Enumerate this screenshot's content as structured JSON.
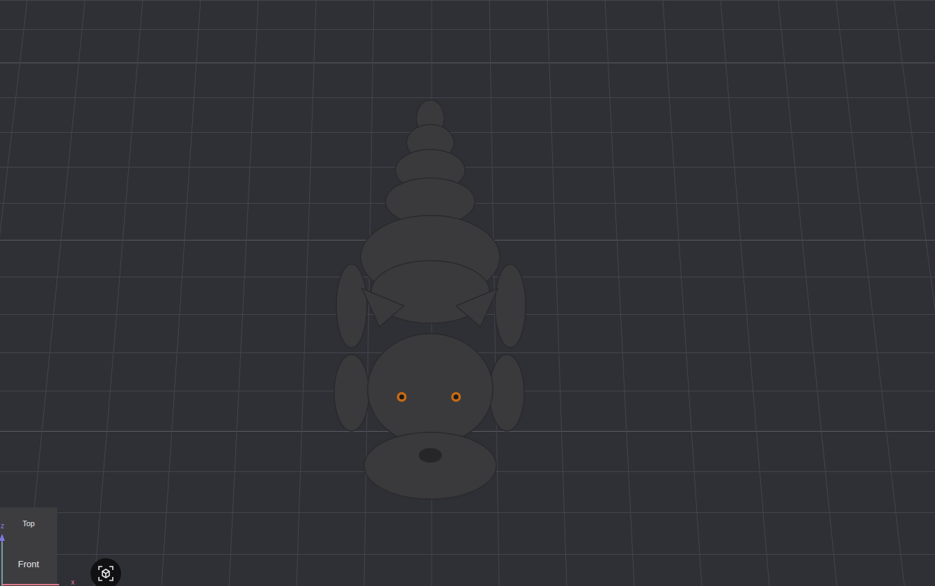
{
  "viewcube": {
    "faces": [
      "Top",
      "Front"
    ]
  },
  "axes": [
    "z",
    "x"
  ]
}
